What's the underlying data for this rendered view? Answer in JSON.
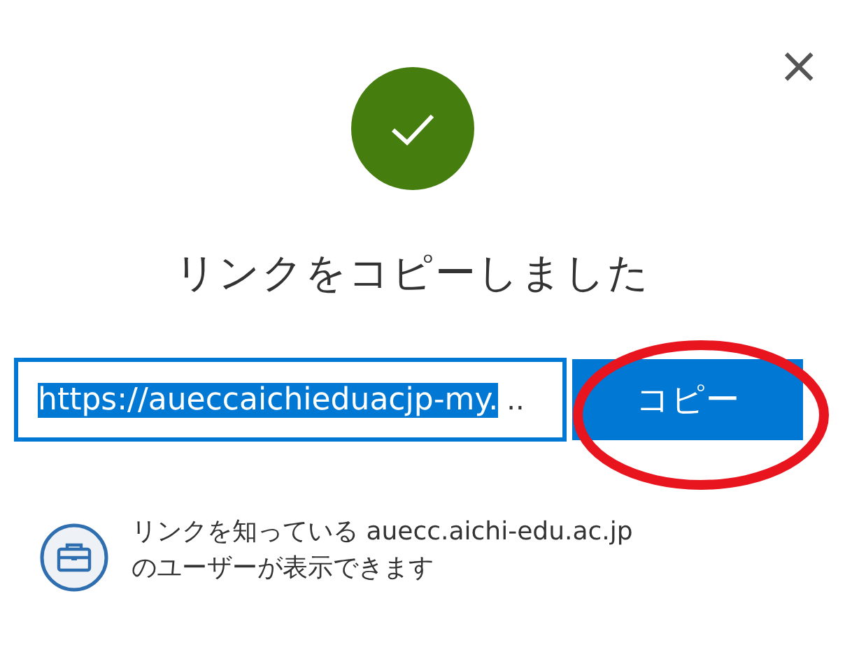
{
  "dialog": {
    "close": "×",
    "title": "リンクをコピーしました"
  },
  "link_field": {
    "value": "https://aueccaichieduacjp-my.",
    "text_selected": true,
    "overflow": ".."
  },
  "copy_button": {
    "label": "コピー"
  },
  "annotation": {
    "kind": "ellipse"
  },
  "access_note": {
    "line_1": "リンクを知っている auecc.aichi-edu.ac.jp",
    "line_2": "のユーザーが表示できます"
  }
}
